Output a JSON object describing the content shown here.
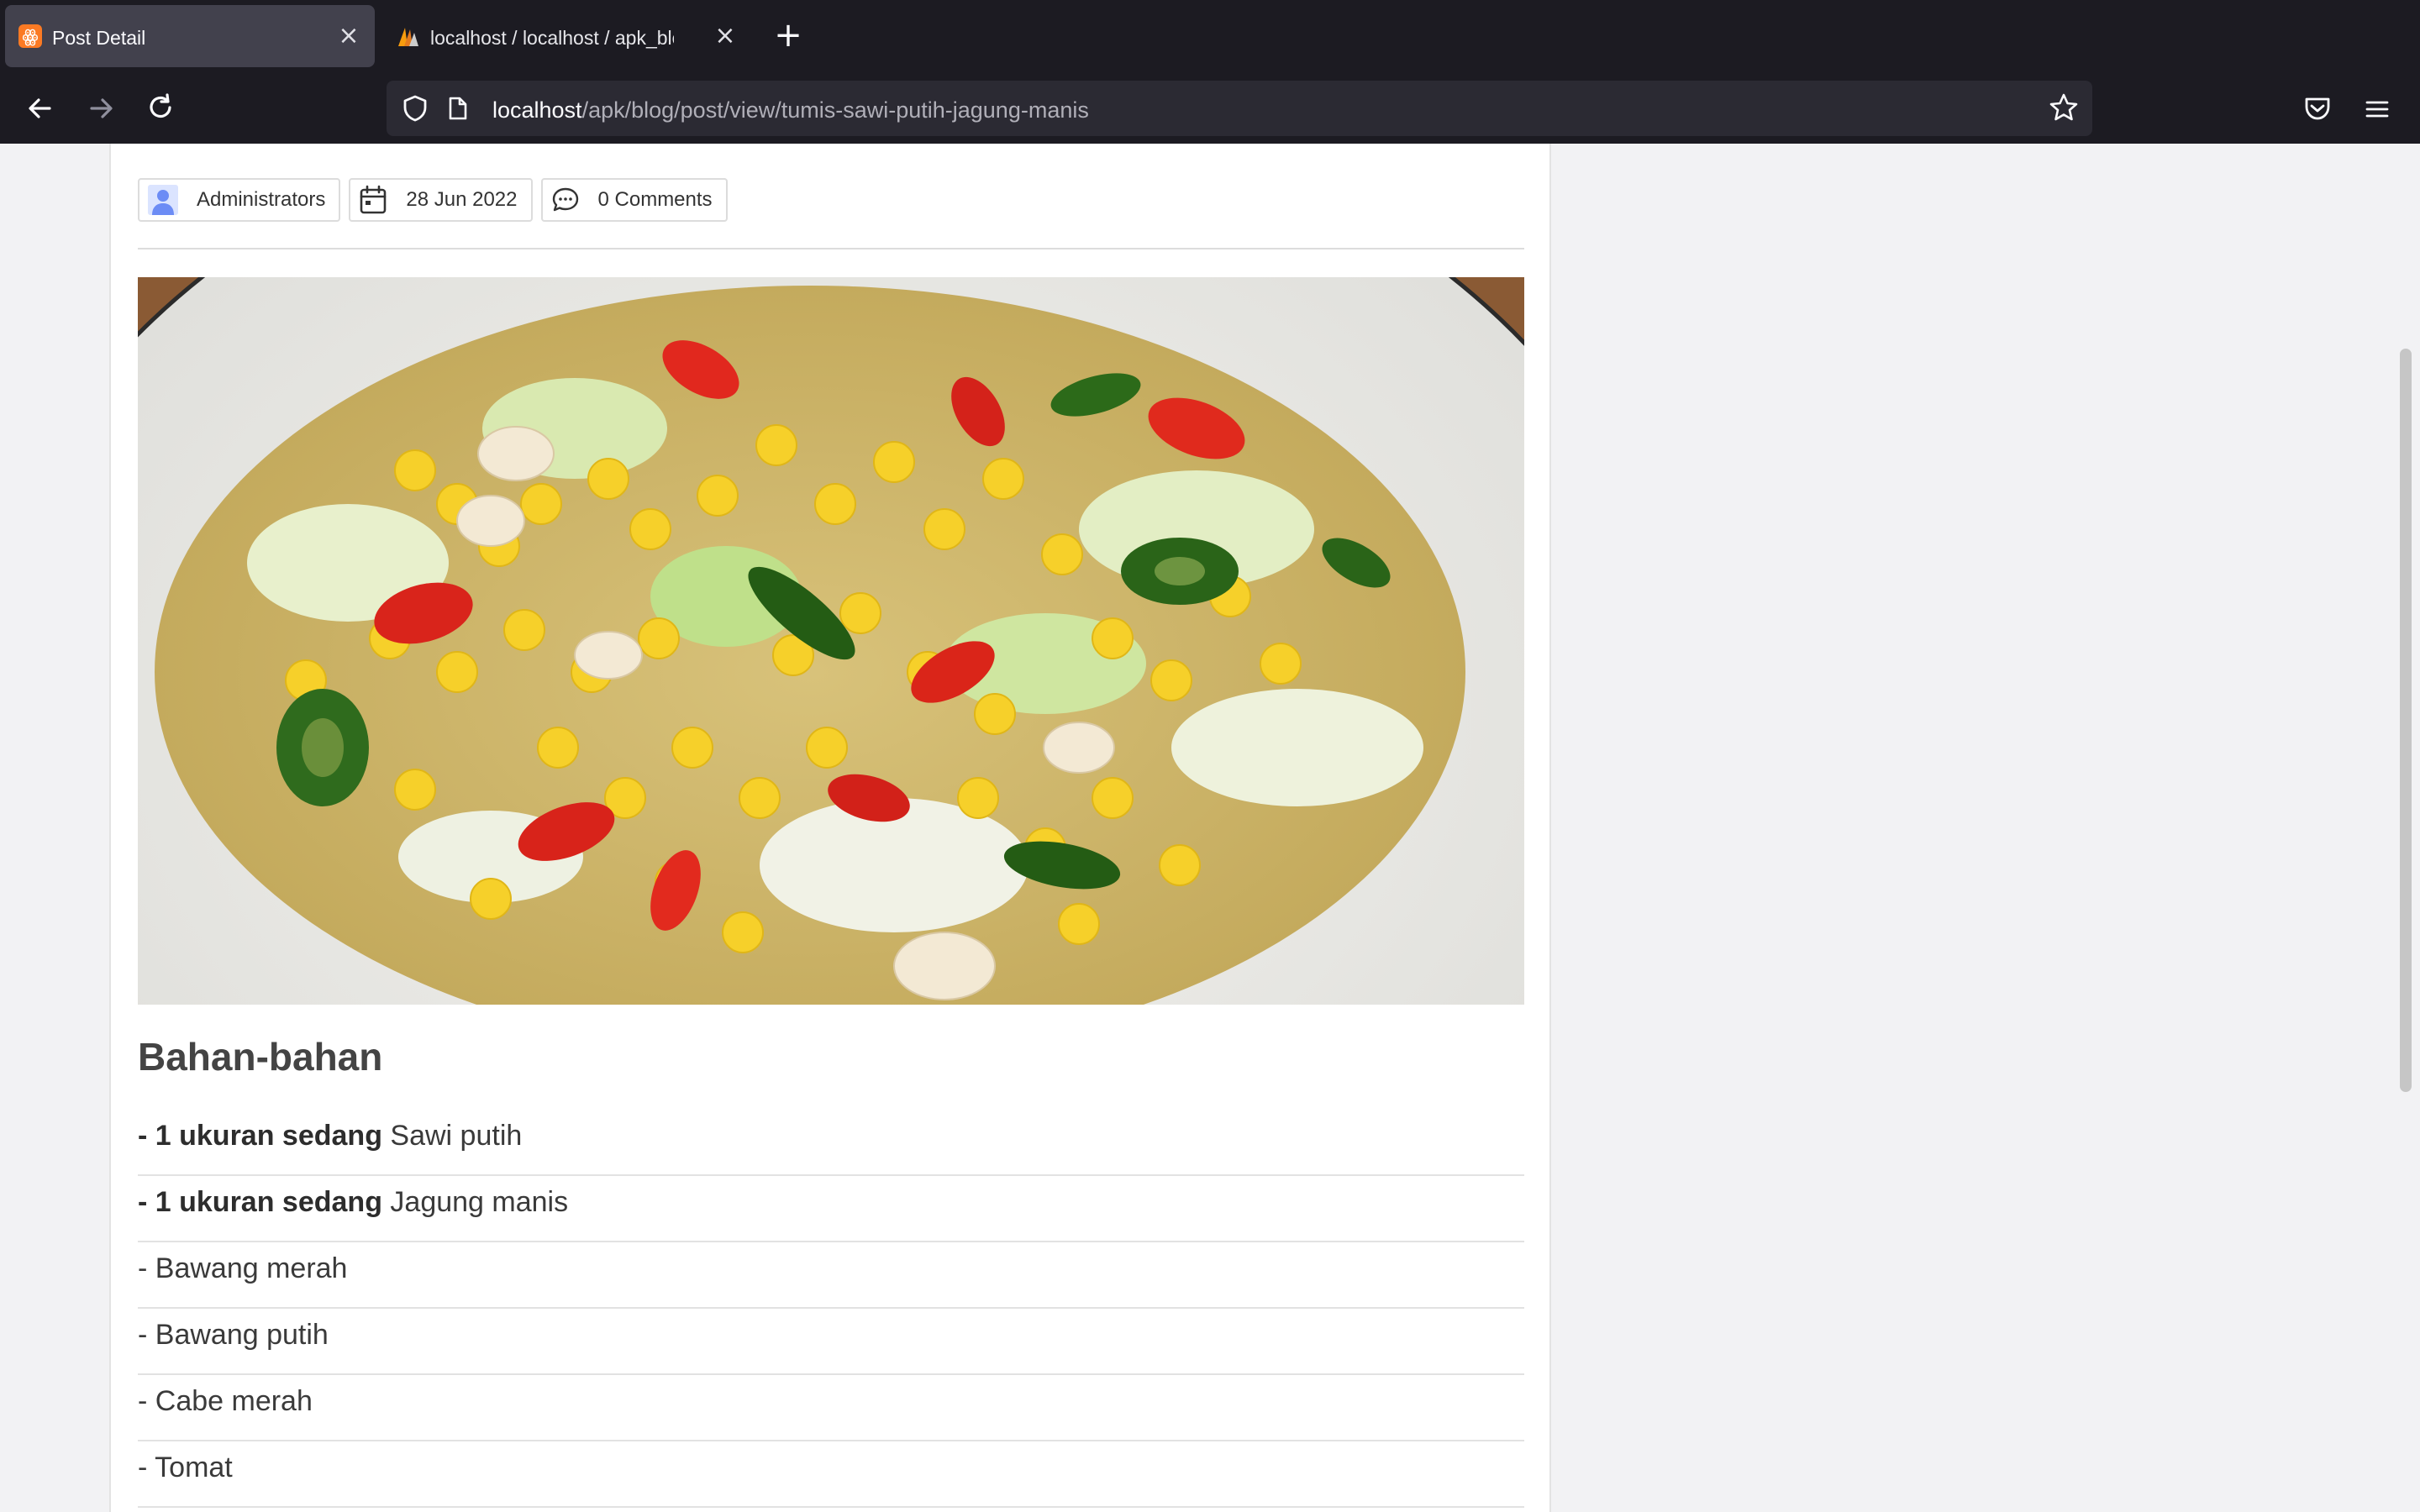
{
  "tabs": [
    {
      "title": "Post Detail",
      "active": true,
      "favicon": "xampp-icon"
    },
    {
      "title": "localhost / localhost / apk_blog / ",
      "active": false,
      "favicon": "phpmyadmin-icon"
    }
  ],
  "address_bar": {
    "host": "localhost",
    "path": "/apk/blog/post/view/tumis-sawi-putih-jagung-manis"
  },
  "post": {
    "author": "Administrators",
    "date": "28 Jun 2022",
    "comments": "0 Comments",
    "image_alt": "Tumis sawi putih jagung manis",
    "section_title": "Bahan-bahan",
    "ingredients": [
      {
        "qty": "- 1 ukuran sedang",
        "name": " Sawi putih"
      },
      {
        "qty": "- 1 ukuran sedang",
        "name": " Jagung manis"
      },
      {
        "qty": "",
        "name": "- Bawang merah"
      },
      {
        "qty": "",
        "name": "- Bawang putih"
      },
      {
        "qty": "",
        "name": "- Cabe merah"
      },
      {
        "qty": "",
        "name": "- Tomat"
      }
    ]
  },
  "colors": {
    "chrome_bg": "#1c1b22",
    "active_tab": "#42414d",
    "url_bar": "#2b2a33",
    "page_bg": "#f2f2f4",
    "card_bg": "#ffffff"
  }
}
